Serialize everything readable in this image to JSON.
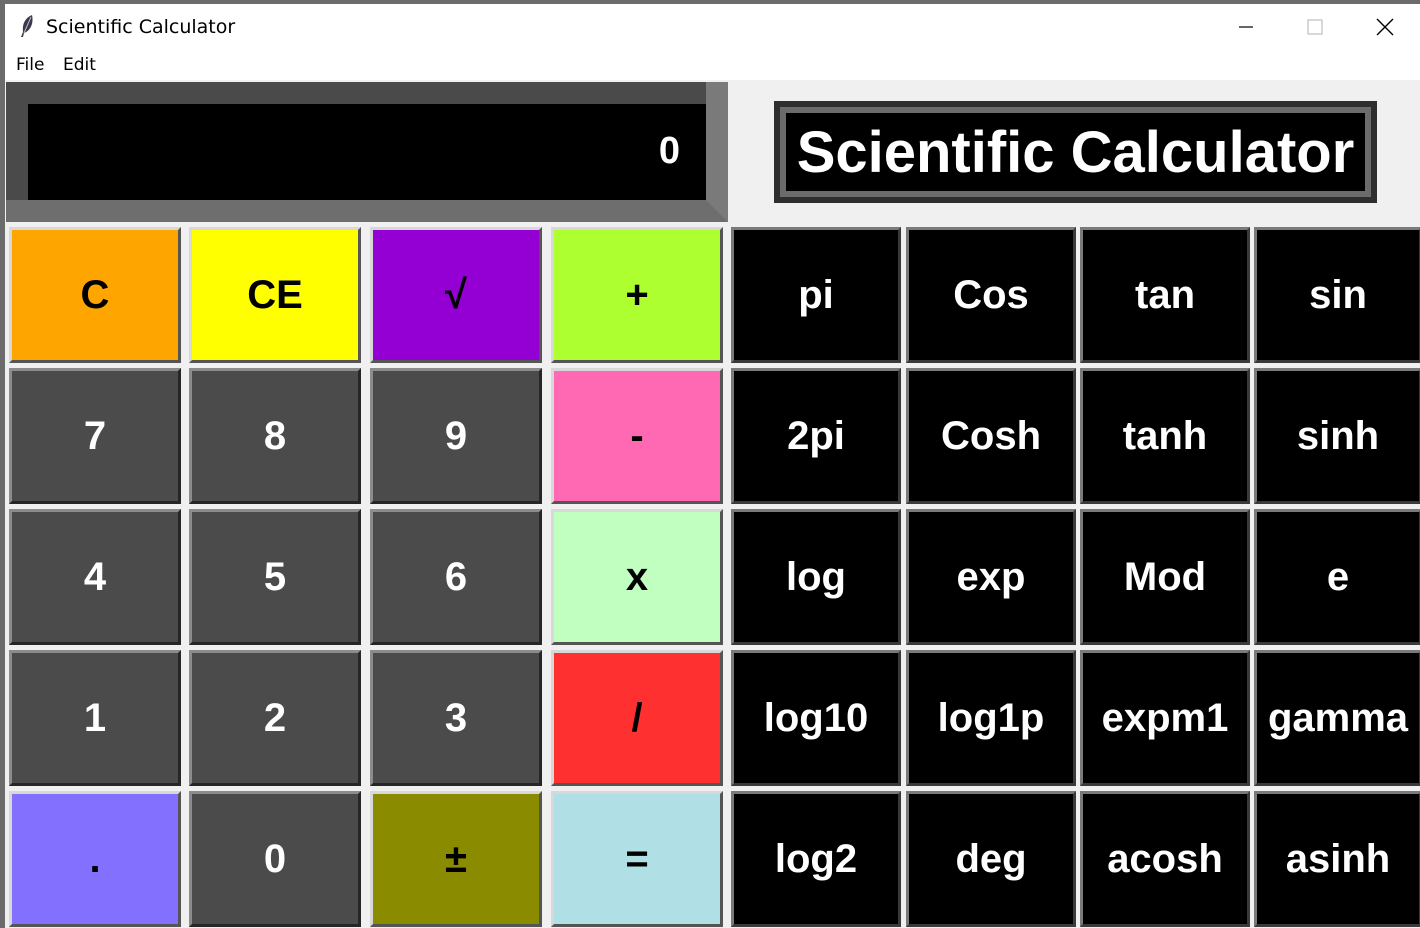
{
  "window": {
    "title": "Scientific Calculator",
    "icon": "feather-icon",
    "controls": [
      "minimize-icon",
      "maximize-icon",
      "close-icon"
    ]
  },
  "menu": {
    "items": [
      "File",
      "Edit"
    ]
  },
  "display": {
    "value": "0"
  },
  "heading": "Scientific Calculator",
  "keypad": {
    "rows": [
      [
        "C",
        "CE",
        "√",
        "+",
        "pi",
        "Cos",
        "tan",
        "sin"
      ],
      [
        "7",
        "8",
        "9",
        "-",
        "2pi",
        "Cosh",
        "tanh",
        "sinh"
      ],
      [
        "4",
        "5",
        "6",
        "x",
        "log",
        "exp",
        "Mod",
        "e"
      ],
      [
        "1",
        "2",
        "3",
        "/",
        "log10",
        "log1p",
        "expm1",
        "gamma"
      ],
      [
        ".",
        "0",
        "±",
        "=",
        "log2",
        "deg",
        "acosh",
        "asinh"
      ]
    ],
    "colors": {
      "C": "#ffa500",
      "CE": "#ffff00",
      "√": "#9400d3",
      "+": "#adff2f",
      "-": "#ff69b4",
      "x": "#c1ffc1",
      "/": "#ff3030",
      ".": "#8470ff",
      "±": "#8b8b00",
      "=": "#b0e0e6"
    }
  }
}
